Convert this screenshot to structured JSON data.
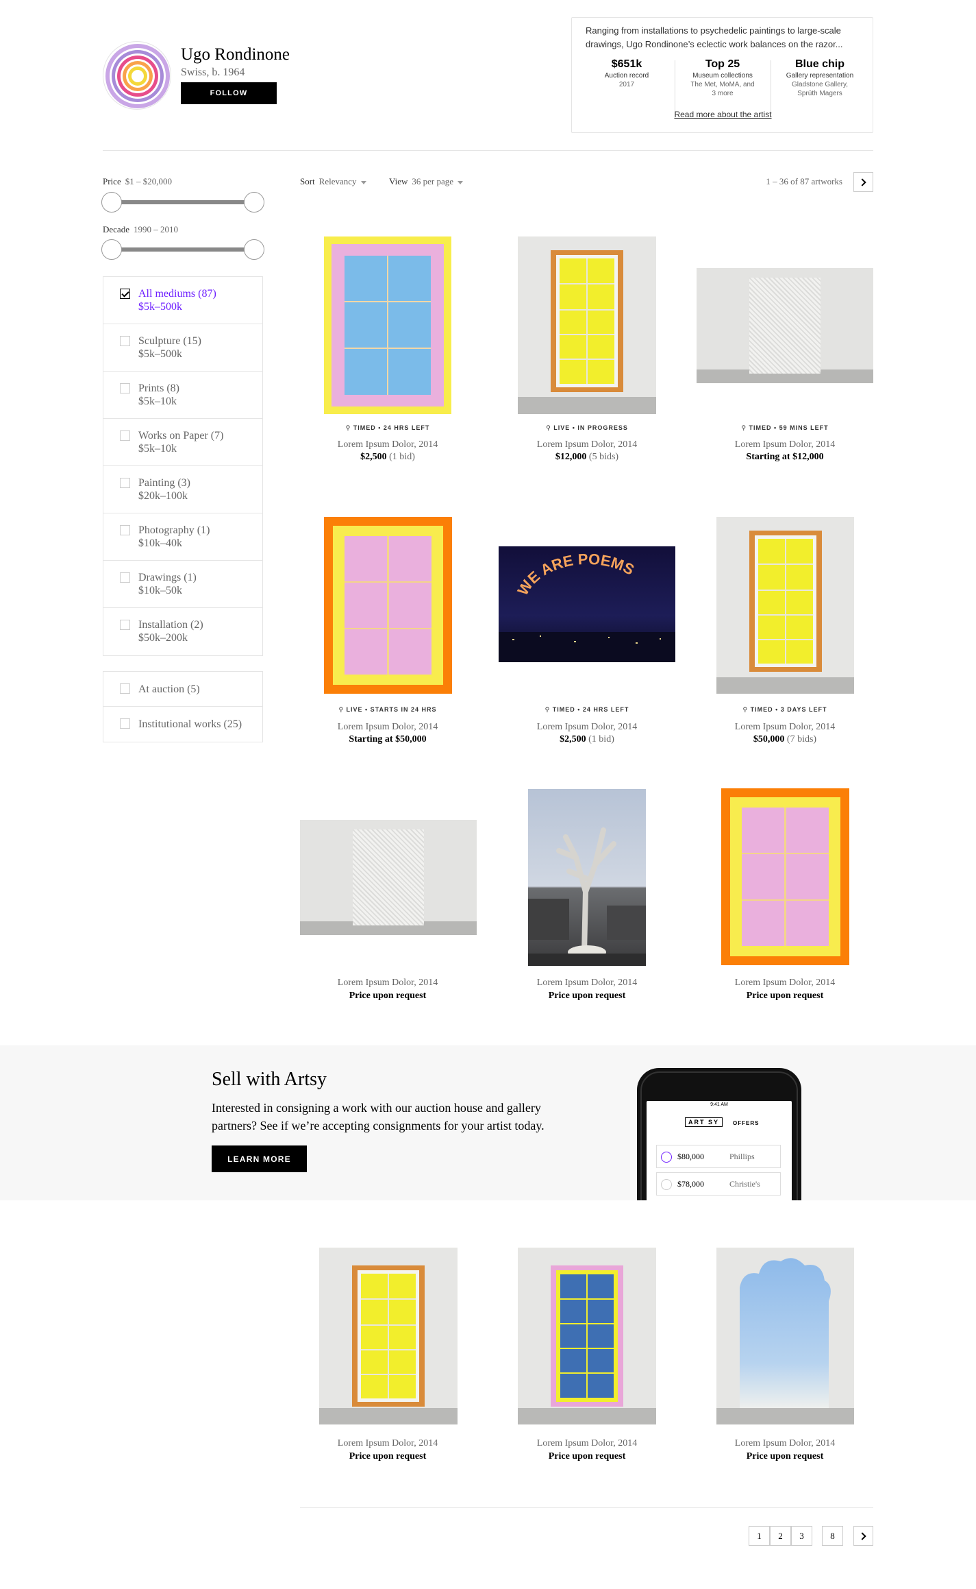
{
  "artist": {
    "name": "Ugo Rondinone",
    "meta": "Swiss, b. 1964",
    "follow_label": "FOLLOW"
  },
  "bio": {
    "text": "Ranging from installations to psychedelic paintings to large-scale drawings, Ugo Rondinone’s eclectic work balances on the razor...",
    "stats": [
      {
        "value": "$651k",
        "label": "Auction record",
        "sub": "2017"
      },
      {
        "value": "Top 25",
        "label": "Museum collections",
        "sub": "The Met, MoMA, and 3 more"
      },
      {
        "value": "Blue chip",
        "label": "Gallery representation",
        "sub": "Gladstone Gallery, Sprüth Magers"
      }
    ],
    "read_more": "Read more about the artist"
  },
  "filters": {
    "price": {
      "label": "Price",
      "value": "$1 – $20,000"
    },
    "decade": {
      "label": "Decade",
      "value": "1990 – 2010"
    },
    "mediums": [
      {
        "label": "All mediums (87)",
        "range": "$5k–500k",
        "checked": true
      },
      {
        "label": "Sculpture (15)",
        "range": "$5k–500k",
        "checked": false
      },
      {
        "label": "Prints (8)",
        "range": "$5k–10k",
        "checked": false
      },
      {
        "label": "Works on Paper (7)",
        "range": "$5k–10k",
        "checked": false
      },
      {
        "label": "Painting (3)",
        "range": "$20k–100k",
        "checked": false
      },
      {
        "label": "Photography (1)",
        "range": "$10k–40k",
        "checked": false
      },
      {
        "label": "Drawings (1)",
        "range": "$10k–50k",
        "checked": false
      },
      {
        "label": "Installation (2)",
        "range": "$50k–200k",
        "checked": false
      }
    ],
    "other": [
      {
        "label": "At auction (5)"
      },
      {
        "label": "Institutional works (25)"
      }
    ]
  },
  "toolbar": {
    "sort_label": "Sort",
    "sort_value": "Relevancy",
    "view_label": "View",
    "view_value": "36 per page",
    "count": "1 – 36 of 87 artworks"
  },
  "artworks": [
    {
      "status": "TIMED • 24 HRS LEFT",
      "title": "Lorem Ipsum Dolor, 2014",
      "price": "$2,500",
      "bids": " (1 bid)"
    },
    {
      "status": "LIVE • IN PROGRESS",
      "title": "Lorem Ipsum Dolor, 2014",
      "price": "$12,000",
      "bids": " (5 bids)"
    },
    {
      "status": "TIMED • 59 MINS LEFT",
      "title": "Lorem Ipsum Dolor, 2014",
      "price": "Starting at $12,000",
      "bids": ""
    },
    {
      "status": "LIVE • STARTS IN 24 HRS",
      "title": "Lorem Ipsum Dolor, 2014",
      "price": "Starting at $50,000",
      "bids": ""
    },
    {
      "status": "TIMED • 24 HRS LEFT",
      "title": "Lorem Ipsum Dolor, 2014",
      "price": "$2,500",
      "bids": " (1 bid)"
    },
    {
      "status": "TIMED • 3 DAYS LEFT",
      "title": "Lorem Ipsum Dolor, 2014",
      "price": "$50,000",
      "bids": " (7 bids)"
    },
    {
      "status": "",
      "title": "Lorem Ipsum Dolor, 2014",
      "price": "Price upon request",
      "bids": ""
    },
    {
      "status": "",
      "title": "Lorem Ipsum Dolor, 2014",
      "price": "Price upon request",
      "bids": ""
    },
    {
      "status": "",
      "title": "Lorem Ipsum Dolor, 2014",
      "price": "Price upon request",
      "bids": ""
    },
    {
      "status": "",
      "title": "Lorem Ipsum Dolor, 2014",
      "price": "Price upon request",
      "bids": ""
    },
    {
      "status": "",
      "title": "Lorem Ipsum Dolor, 2014",
      "price": "Price upon request",
      "bids": ""
    },
    {
      "status": "",
      "title": "Lorem Ipsum Dolor, 2014",
      "price": "Price upon request",
      "bids": ""
    }
  ],
  "sell": {
    "title": "Sell with Artsy",
    "body": "Interested in consigning a work with our auction house and gallery partners? See if we’re accepting consignments for your artist today.",
    "button": "LEARN MORE",
    "phone": {
      "time": "9:41 AM",
      "logo": "ART SY",
      "tab": "OFFERS",
      "offers": [
        {
          "amount": "$80,000",
          "house": "Phillips"
        },
        {
          "amount": "$78,000",
          "house": "Christie's"
        }
      ]
    }
  },
  "artwork_image_text": "WE ARE POEMS",
  "pagination": {
    "pages": [
      "1",
      "2",
      "3",
      "8"
    ]
  },
  "colors": {
    "accent": "#6e1fff",
    "black": "#000000"
  }
}
